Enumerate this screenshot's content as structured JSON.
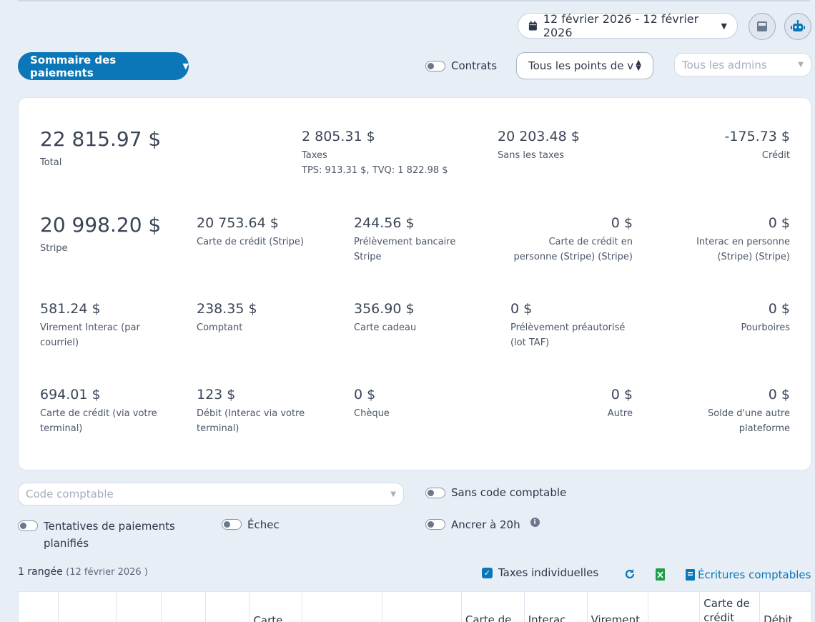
{
  "header": {
    "date_range": "12 février 2026 - 12 février 2026",
    "icons": [
      "calendar-icon",
      "calculator-icon",
      "robot-icon"
    ]
  },
  "toolbar": {
    "summary_button": "Sommaire des paiements",
    "contracts_label": "Contrats",
    "points_of_sale_select": "Tous les points de v",
    "admins_placeholder": "Tous les admins"
  },
  "summary": {
    "total": {
      "value": "22 815.97 $",
      "label": "Total"
    },
    "taxes": {
      "value": "2 805.31 $",
      "label": "Taxes",
      "detail": "TPS: 913.31 $, TVQ: 1 822.98 $"
    },
    "without_taxes": {
      "value": "20 203.48 $",
      "label": "Sans les taxes"
    },
    "credit": {
      "value": "-175.73 $",
      "label": "Crédit"
    },
    "stripe": {
      "value": "20 998.20 $",
      "label": "Stripe"
    },
    "stripe_card": {
      "value": "20 753.64 $",
      "label": "Carte de crédit (Stripe)"
    },
    "stripe_debit": {
      "value": "244.56 $",
      "label1": "Prélèvement bancaire",
      "label2": "Stripe"
    },
    "stripe_in_person": {
      "value": "0 $",
      "label1": "Carte de crédit en",
      "label2": "personne (Stripe) (Stripe)"
    },
    "interac_in_person": {
      "value": "0 $",
      "label1": "Interac en personne",
      "label2": "(Stripe) (Stripe)"
    },
    "interac_email": {
      "value": "581.24 $",
      "label1": "Virement Interac (par",
      "label2": "courriel)"
    },
    "cash": {
      "value": "238.35 $",
      "label": "Comptant"
    },
    "gift_card": {
      "value": "356.90 $",
      "label": "Carte cadeau"
    },
    "preauth": {
      "value": "0 $",
      "label1": "Prélèvement préautorisé",
      "label2": "(lot TAF)"
    },
    "tips": {
      "value": "0 $",
      "label": "Pourboires"
    },
    "terminal_card": {
      "value": "694.01 $",
      "label1": "Carte de crédit (via votre",
      "label2": "terminal)"
    },
    "terminal_debit": {
      "value": "123 $",
      "label1": "Débit (Interac via votre",
      "label2": "terminal)"
    },
    "cheque": {
      "value": "0 $",
      "label": "Chèque"
    },
    "other": {
      "value": "0 $",
      "label": "Autre"
    },
    "other_platform": {
      "value": "0 $",
      "label1": "Solde d'une autre",
      "label2": "plateforme"
    }
  },
  "filters": {
    "accounting_code_placeholder": "Code comptable",
    "no_accounting_code": "Sans code comptable",
    "scheduled_attempts1": "Tentatives de paiements",
    "scheduled_attempts2": "planifiés",
    "failed": "Échec",
    "anchor": "Ancrer à 20h"
  },
  "results": {
    "rows": "1 rangée",
    "date_note": "(12 février 2026 )",
    "individual_taxes": "Taxes individuelles",
    "accounting_entries": "Écritures comptables"
  },
  "table_headers": [
    "",
    "",
    "",
    "",
    "",
    "Carte",
    "",
    "",
    "Carte de",
    "Interac",
    "Virement",
    "",
    "Carte de crédit",
    "Débit"
  ]
}
